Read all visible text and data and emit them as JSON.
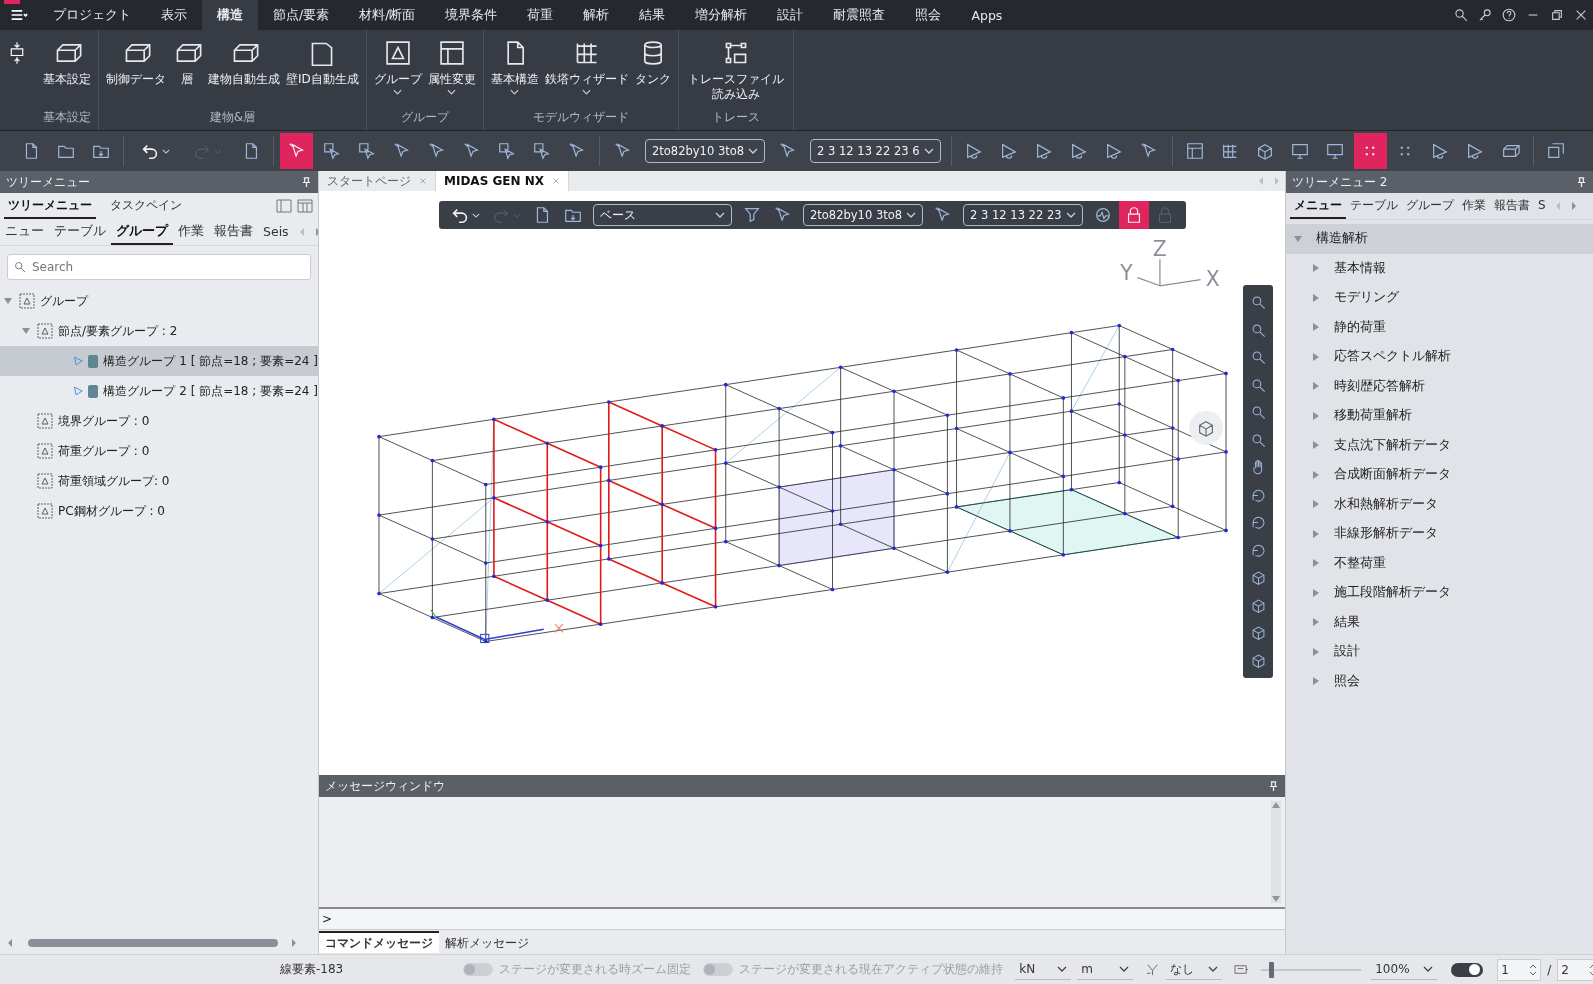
{
  "menu_bar": {
    "items": [
      {
        "label": "プロジェクト",
        "selected": false
      },
      {
        "label": "表示",
        "selected": false
      },
      {
        "label": "構造",
        "selected": true
      },
      {
        "label": "節点/要素",
        "selected": false
      },
      {
        "label": "材料/断面",
        "selected": false
      },
      {
        "label": "境界条件",
        "selected": false
      },
      {
        "label": "荷重",
        "selected": false
      },
      {
        "label": "解析",
        "selected": false
      },
      {
        "label": "結果",
        "selected": false
      },
      {
        "label": "増分解析",
        "selected": false
      },
      {
        "label": "設計",
        "selected": false
      },
      {
        "label": "耐震照査",
        "selected": false
      },
      {
        "label": "照会",
        "selected": false
      },
      {
        "label": "Apps",
        "selected": false
      }
    ]
  },
  "ribbon": {
    "groups": [
      {
        "label": "基本設定",
        "buttons": [
          {
            "label": "基本設定",
            "dropdown": false
          }
        ]
      },
      {
        "label": "建物&層",
        "buttons": [
          {
            "label": "制御データ",
            "dropdown": false
          },
          {
            "label": "層",
            "dropdown": false
          },
          {
            "label": "建物自動生成",
            "dropdown": false
          },
          {
            "label": "壁ID自動生成",
            "dropdown": false
          }
        ]
      },
      {
        "label": "グループ",
        "buttons": [
          {
            "label": "グループ",
            "dropdown": true
          },
          {
            "label": "属性変更",
            "dropdown": true
          }
        ]
      },
      {
        "label": "モデルウィザード",
        "buttons": [
          {
            "label": "基本構造",
            "dropdown": true
          },
          {
            "label": "鉄塔ウィザード",
            "dropdown": true
          },
          {
            "label": "タンク",
            "dropdown": false
          }
        ]
      },
      {
        "label": "トレース",
        "buttons": [
          {
            "label": "トレースファイル読み込み",
            "dropdown": false
          }
        ]
      }
    ]
  },
  "toolbar": {
    "groups": [
      {
        "items": [
          {
            "kind": "button",
            "selected": false
          },
          {
            "kind": "button",
            "selected": false
          },
          {
            "kind": "button",
            "selected": false
          }
        ]
      },
      {
        "items": [
          {
            "kind": "split",
            "disabled": false
          },
          {
            "kind": "split",
            "disabled": true
          },
          {
            "kind": "button",
            "selected": false
          }
        ]
      },
      {
        "items": [
          {
            "kind": "button",
            "selected": true
          },
          {
            "kind": "button",
            "selected": false
          },
          {
            "kind": "button",
            "selected": false
          },
          {
            "kind": "button",
            "selected": false
          },
          {
            "kind": "button",
            "selected": false
          },
          {
            "kind": "button",
            "selected": false
          },
          {
            "kind": "button",
            "selected": false
          },
          {
            "kind": "button",
            "selected": false
          },
          {
            "kind": "button",
            "selected": false
          }
        ]
      },
      {
        "items": [
          {
            "kind": "button",
            "selected": false
          },
          {
            "kind": "combo",
            "value": "2to82by10 3to8"
          },
          {
            "kind": "button",
            "selected": false
          },
          {
            "kind": "combo",
            "value": "2 3 12 13 22 23 6"
          }
        ]
      },
      {
        "items": [
          {
            "kind": "button",
            "selected": false
          },
          {
            "kind": "button",
            "selected": false
          },
          {
            "kind": "button",
            "selected": false
          },
          {
            "kind": "button",
            "selected": false
          },
          {
            "kind": "button",
            "selected": false
          },
          {
            "kind": "button",
            "selected": false
          }
        ]
      },
      {
        "items": [
          {
            "kind": "button",
            "selected": false
          },
          {
            "kind": "button",
            "selected": false
          },
          {
            "kind": "button",
            "selected": false
          },
          {
            "kind": "button",
            "selected": false
          },
          {
            "kind": "button",
            "selected": false
          },
          {
            "kind": "button",
            "selected": true
          },
          {
            "kind": "button",
            "selected": false
          },
          {
            "kind": "button",
            "selected": false
          },
          {
            "kind": "button",
            "selected": false
          },
          {
            "kind": "button",
            "selected": false
          }
        ]
      },
      {
        "items": [
          {
            "kind": "button",
            "selected": false
          }
        ]
      }
    ]
  },
  "left_panel": {
    "title": "ツリーメニュー",
    "tabs": [
      {
        "label": "ツリーメニュー",
        "selected": true
      },
      {
        "label": "タスクペイン",
        "selected": false
      }
    ],
    "subtabs": [
      {
        "label": "ニュー",
        "selected": false
      },
      {
        "label": "テーブル",
        "selected": false
      },
      {
        "label": "グループ",
        "selected": true
      },
      {
        "label": "作業",
        "selected": false
      },
      {
        "label": "報告書",
        "selected": false
      },
      {
        "label": "Seis",
        "selected": false
      }
    ],
    "search": {
      "placeholder": "Search"
    },
    "tree": [
      {
        "label": "グループ",
        "expanded": true,
        "selected": false,
        "children": [
          {
            "label": "節点/要素グループ : 2",
            "expanded": true,
            "selected": false,
            "children": [
              {
                "label": "構造グループ 1 [ 節点=18 ; 要素=24 ]",
                "selected": true,
                "color": "#5e8793"
              },
              {
                "label": "構造グループ 2 [ 節点=18 ; 要素=24 ]",
                "selected": false,
                "color": "#5e8793"
              }
            ]
          },
          {
            "label": "境界グループ : 0",
            "selected": false
          },
          {
            "label": "荷重グループ : 0",
            "selected": false
          },
          {
            "label": "荷重領域グループ: 0",
            "selected": false
          },
          {
            "label": "PC鋼材グループ : 0",
            "selected": false
          }
        ]
      }
    ]
  },
  "document_tabs": [
    {
      "label": "スタートページ",
      "selected": false
    },
    {
      "label": "MIDAS GEN NX",
      "selected": true
    }
  ],
  "view_toolbar": {
    "items": [
      {
        "kind": "split",
        "disabled": false
      },
      {
        "kind": "split",
        "disabled": true
      },
      {
        "kind": "button",
        "selected": false
      },
      {
        "kind": "button",
        "selected": false
      },
      {
        "kind": "combo",
        "value": "ベース",
        "wide": true
      },
      {
        "kind": "button",
        "selected": false
      },
      {
        "kind": "button",
        "selected": false
      },
      {
        "kind": "combo",
        "value": "2to82by10 3to8"
      },
      {
        "kind": "button",
        "selected": false
      },
      {
        "kind": "combo",
        "value": "2 3 12 13 22 23"
      },
      {
        "kind": "button",
        "selected": false
      },
      {
        "kind": "button",
        "selected": true
      },
      {
        "kind": "button",
        "selected": false,
        "disabled": true
      }
    ]
  },
  "viewport": {
    "axes": [
      "Z",
      "Y",
      "X"
    ]
  },
  "right_panel": {
    "title": "ツリーメニュー 2",
    "tabs": [
      {
        "label": "メニュー",
        "selected": true
      },
      {
        "label": "テーブル",
        "selected": false
      },
      {
        "label": "グループ",
        "selected": false
      },
      {
        "label": "作業",
        "selected": false
      },
      {
        "label": "報告書",
        "selected": false
      },
      {
        "label": "S",
        "selected": false
      }
    ],
    "tree": [
      {
        "label": "構造解析",
        "expanded": true,
        "selected": true,
        "children": [
          {
            "label": "基本情報",
            "expanded": false,
            "selected": false
          },
          {
            "label": "モデリング",
            "expanded": false,
            "selected": false
          },
          {
            "label": "静的荷重",
            "expanded": false,
            "selected": false
          },
          {
            "label": "応答スペクトル解析",
            "expanded": false,
            "selected": false
          },
          {
            "label": "時刻歴応答解析",
            "expanded": false,
            "selected": false
          },
          {
            "label": "移動荷重解析",
            "expanded": false,
            "selected": false
          },
          {
            "label": "支点沈下解析データ",
            "expanded": false,
            "selected": false
          },
          {
            "label": "合成断面解析データ",
            "expanded": false,
            "selected": false
          },
          {
            "label": "水和熱解析データ",
            "expanded": false,
            "selected": false
          },
          {
            "label": "非線形解析データ",
            "expanded": false,
            "selected": false
          },
          {
            "label": "不整荷重",
            "expanded": false,
            "selected": false
          },
          {
            "label": "施工段階解析データ",
            "expanded": false,
            "selected": false
          },
          {
            "label": "結果",
            "expanded": false,
            "selected": false
          },
          {
            "label": "設計",
            "expanded": false,
            "selected": false
          },
          {
            "label": "照会",
            "expanded": false,
            "selected": false
          }
        ]
      }
    ]
  },
  "message_window": {
    "title": "メッセージウィンドウ",
    "prompt": ">",
    "tabs": [
      {
        "label": "コマンドメッセージ",
        "selected": true
      },
      {
        "label": "解析メッセージ",
        "selected": false
      }
    ]
  },
  "status_bar": {
    "element": "線要素-183",
    "toggles": [
      {
        "label": "ステージが変更される時ズーム固定",
        "on": false,
        "disabled": true
      },
      {
        "label": "ステージが変更される現在アクティブ状態の維持",
        "on": false,
        "disabled": true
      }
    ],
    "units": [
      "kN",
      "m"
    ],
    "option": "なし",
    "slider": {
      "level": 0.08
    },
    "zoom": "100%",
    "view_toggle": {
      "on": true
    },
    "page": "1",
    "page_separator": "/",
    "pages": "2"
  }
}
